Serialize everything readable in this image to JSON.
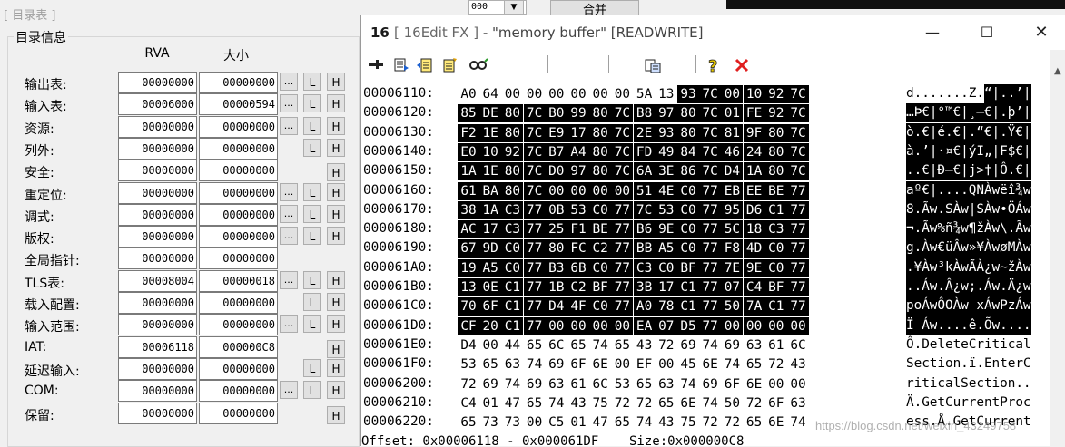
{
  "background": {
    "combo_value": "000",
    "merge_label": "合并"
  },
  "dir_dialog": {
    "title": "[ 目录表 ]",
    "group_label": "目录信息",
    "col_rva": "RVA",
    "col_size": "大小",
    "rows": [
      {
        "label": "输出表:",
        "rva": "00000000",
        "size": "00000000",
        "more": true,
        "l": true,
        "h": true
      },
      {
        "label": "输入表:",
        "rva": "00006000",
        "size": "00000594",
        "more": true,
        "l": true,
        "h": true
      },
      {
        "label": "资源:",
        "rva": "00000000",
        "size": "00000000",
        "more": true,
        "l": true,
        "h": true
      },
      {
        "label": "列外:",
        "rva": "00000000",
        "size": "00000000",
        "more": false,
        "l": true,
        "h": true
      },
      {
        "label": "安全:",
        "rva": "00000000",
        "size": "00000000",
        "more": false,
        "l": false,
        "h": true
      },
      {
        "label": "重定位:",
        "rva": "00000000",
        "size": "00000000",
        "more": true,
        "l": true,
        "h": true
      },
      {
        "label": "调式:",
        "rva": "00000000",
        "size": "00000000",
        "more": true,
        "l": true,
        "h": true
      },
      {
        "label": "版权:",
        "rva": "00000000",
        "size": "00000000",
        "more": true,
        "l": true,
        "h": true
      },
      {
        "label": "全局指针:",
        "rva": "00000000",
        "size": "00000000",
        "more": false,
        "l": false,
        "h": false
      },
      {
        "label": "TLS表:",
        "rva": "00008004",
        "size": "00000018",
        "more": true,
        "l": true,
        "h": true
      },
      {
        "label": "载入配置:",
        "rva": "00000000",
        "size": "00000000",
        "more": false,
        "l": true,
        "h": true
      },
      {
        "label": "输入范围:",
        "rva": "00000000",
        "size": "00000000",
        "more": true,
        "l": true,
        "h": true
      },
      {
        "label": "IAT:",
        "rva": "00006118",
        "size": "000000C8",
        "more": false,
        "l": false,
        "h": true
      },
      {
        "label": "延迟输入:",
        "rva": "00000000",
        "size": "00000000",
        "more": false,
        "l": true,
        "h": true
      },
      {
        "label": "COM:",
        "rva": "00000000",
        "size": "00000000",
        "more": true,
        "l": true,
        "h": true
      },
      {
        "label": "保留:",
        "rva": "00000000",
        "size": "00000000",
        "more": false,
        "l": false,
        "h": true
      }
    ],
    "btn_more": "...",
    "btn_l": "L",
    "btn_h": "H"
  },
  "hex_window": {
    "app_icon": "16",
    "title_prefix": "[ 16Edit FX ]",
    "title_rest": " - \"memory buffer\" [READWRITE]",
    "minimize": "—",
    "maximize": "☐",
    "close": "✕",
    "toolbar_icons": [
      "pin-icon",
      "copy-doc-icon",
      "new-doc-icon",
      "edit-doc-icon",
      "search-icon",
      "paste-icon",
      "help-icon",
      "close-red-icon"
    ],
    "selection_start_line": 0,
    "selection_start_byte": 10,
    "selection_end_line": 12,
    "selection_end_byte": 15,
    "lines": [
      {
        "offset": "00006110:",
        "bytes": [
          "A0",
          "64",
          "00",
          "00",
          "00",
          "00",
          "00",
          "00",
          "5A",
          "13",
          "93",
          "7C",
          "00",
          "10",
          "92",
          "7C"
        ],
        "ascii": "d.......Z.“|..’|"
      },
      {
        "offset": "00006120:",
        "bytes": [
          "85",
          "DE",
          "80",
          "7C",
          "B0",
          "99",
          "80",
          "7C",
          "B8",
          "97",
          "80",
          "7C",
          "01",
          "FE",
          "92",
          "7C"
        ],
        "ascii": "…Þ€|°™€|¸—€|.þ’|"
      },
      {
        "offset": "00006130:",
        "bytes": [
          "F2",
          "1E",
          "80",
          "7C",
          "E9",
          "17",
          "80",
          "7C",
          "2E",
          "93",
          "80",
          "7C",
          "81",
          "9F",
          "80",
          "7C"
        ],
        "ascii": "ò.€|é.€|.“€|.Ÿ€|"
      },
      {
        "offset": "00006140:",
        "bytes": [
          "E0",
          "10",
          "92",
          "7C",
          "B7",
          "A4",
          "80",
          "7C",
          "FD",
          "49",
          "84",
          "7C",
          "46",
          "24",
          "80",
          "7C"
        ],
        "ascii": "à.’|·¤€|ýI„|F$€|"
      },
      {
        "offset": "00006150:",
        "bytes": [
          "1A",
          "1E",
          "80",
          "7C",
          "D0",
          "97",
          "80",
          "7C",
          "6A",
          "3E",
          "86",
          "7C",
          "D4",
          "1A",
          "80",
          "7C"
        ],
        "ascii": "..€|Ð—€|j>†|Ô.€|"
      },
      {
        "offset": "00006160:",
        "bytes": [
          "61",
          "BA",
          "80",
          "7C",
          "00",
          "00",
          "00",
          "00",
          "51",
          "4E",
          "C0",
          "77",
          "EB",
          "EE",
          "BE",
          "77"
        ],
        "ascii": "aº€|....QNÀwëî¾w"
      },
      {
        "offset": "00006170:",
        "bytes": [
          "38",
          "1A",
          "C3",
          "77",
          "0B",
          "53",
          "C0",
          "77",
          "7C",
          "53",
          "C0",
          "77",
          "95",
          "D6",
          "C1",
          "77"
        ],
        "ascii": "8.Ãw.SÀw|SÀw•ÖÁw"
      },
      {
        "offset": "00006180:",
        "bytes": [
          "AC",
          "17",
          "C3",
          "77",
          "25",
          "F1",
          "BE",
          "77",
          "B6",
          "9E",
          "C0",
          "77",
          "5C",
          "18",
          "C3",
          "77"
        ],
        "ascii": "¬.Ãw%ñ¾w¶žÀw\\.Ãw"
      },
      {
        "offset": "00006190:",
        "bytes": [
          "67",
          "9D",
          "C0",
          "77",
          "80",
          "FC",
          "C2",
          "77",
          "BB",
          "A5",
          "C0",
          "77",
          "F8",
          "4D",
          "C0",
          "77"
        ],
        "ascii": "g.Àw€üÂw»¥ÀwøMÀw"
      },
      {
        "offset": "000061A0:",
        "bytes": [
          "19",
          "A5",
          "C0",
          "77",
          "B3",
          "6B",
          "C0",
          "77",
          "C3",
          "C0",
          "BF",
          "77",
          "7E",
          "9E",
          "C0",
          "77"
        ],
        "ascii": ".¥Àw³kÀwÃÀ¿w~žÀw"
      },
      {
        "offset": "000061B0:",
        "bytes": [
          "13",
          "0E",
          "C1",
          "77",
          "1B",
          "C2",
          "BF",
          "77",
          "3B",
          "17",
          "C1",
          "77",
          "07",
          "C4",
          "BF",
          "77"
        ],
        "ascii": "..Áw.Â¿w;.Áw.Ä¿w"
      },
      {
        "offset": "000061C0:",
        "bytes": [
          "70",
          "6F",
          "C1",
          "77",
          "D4",
          "4F",
          "C0",
          "77",
          "A0",
          "78",
          "C1",
          "77",
          "50",
          "7A",
          "C1",
          "77"
        ],
        "ascii": "poÁwÔOÀw xÁwPzÁw"
      },
      {
        "offset": "000061D0:",
        "bytes": [
          "CF",
          "20",
          "C1",
          "77",
          "00",
          "00",
          "00",
          "00",
          "EA",
          "07",
          "D5",
          "77",
          "00",
          "00",
          "00",
          "00"
        ],
        "ascii": "Ï Áw....ê.Õw...."
      },
      {
        "offset": "000061E0:",
        "bytes": [
          "D4",
          "00",
          "44",
          "65",
          "6C",
          "65",
          "74",
          "65",
          "43",
          "72",
          "69",
          "74",
          "69",
          "63",
          "61",
          "6C"
        ],
        "ascii": "Ô.DeleteCritical"
      },
      {
        "offset": "000061F0:",
        "bytes": [
          "53",
          "65",
          "63",
          "74",
          "69",
          "6F",
          "6E",
          "00",
          "EF",
          "00",
          "45",
          "6E",
          "74",
          "65",
          "72",
          "43"
        ],
        "ascii": "Section.ï.EnterC"
      },
      {
        "offset": "00006200:",
        "bytes": [
          "72",
          "69",
          "74",
          "69",
          "63",
          "61",
          "6C",
          "53",
          "65",
          "63",
          "74",
          "69",
          "6F",
          "6E",
          "00",
          "00"
        ],
        "ascii": "riticalSection.."
      },
      {
        "offset": "00006210:",
        "bytes": [
          "C4",
          "01",
          "47",
          "65",
          "74",
          "43",
          "75",
          "72",
          "72",
          "65",
          "6E",
          "74",
          "50",
          "72",
          "6F",
          "63"
        ],
        "ascii": "Ä.GetCurrentProc"
      },
      {
        "offset": "00006220:",
        "bytes": [
          "65",
          "73",
          "73",
          "00",
          "C5",
          "01",
          "47",
          "65",
          "74",
          "43",
          "75",
          "72",
          "72",
          "65",
          "6E",
          "74"
        ],
        "ascii": "ess.Å.GetCurrent"
      }
    ],
    "status_text": "Offset: 0x00006118 - 0x000061DF    Size:0x000000C8",
    "watermark": "https://blog.csdn.net/weixin_43249758"
  }
}
